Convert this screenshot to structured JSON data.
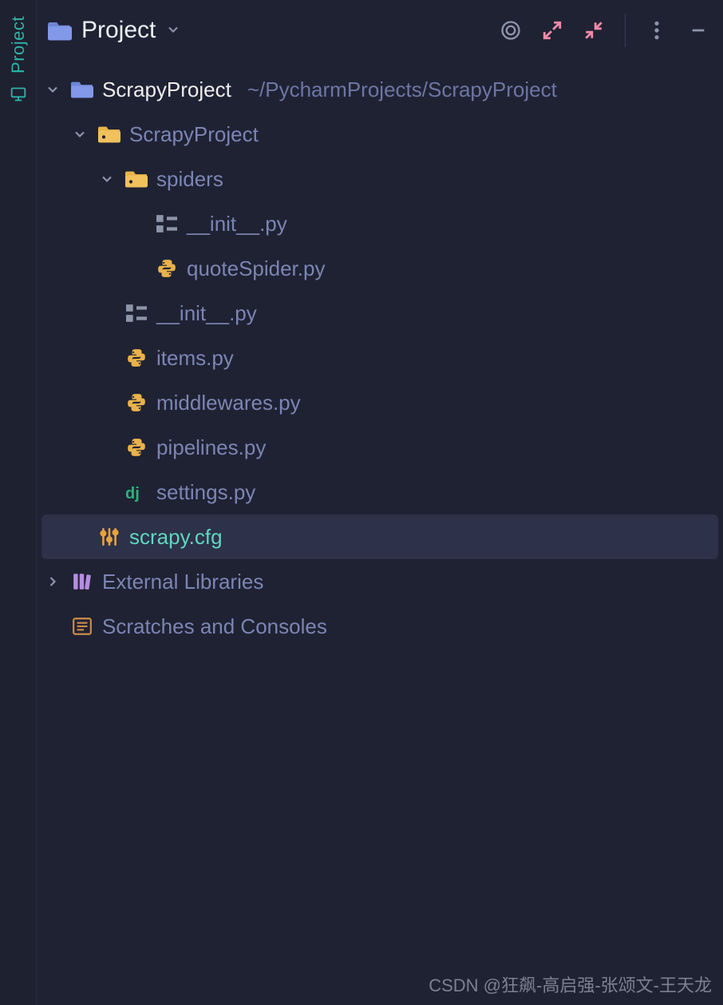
{
  "sidebar": {
    "tool_label": "Project"
  },
  "header": {
    "title": "Project"
  },
  "tree": {
    "root": {
      "name": "ScrapyProject",
      "path": "~/PycharmProjects/ScrapyProject"
    },
    "pkg": {
      "name": "ScrapyProject"
    },
    "spiders": {
      "name": "spiders"
    },
    "files": {
      "spiders_init": "__init__.py",
      "quoteSpider": "quoteSpider.py",
      "pkg_init": "__init__.py",
      "items": "items.py",
      "middlewares": "middlewares.py",
      "pipelines": "pipelines.py",
      "settings": "settings.py",
      "scrapy_cfg": "scrapy.cfg"
    },
    "external_libraries": "External Libraries",
    "scratches": "Scratches and Consoles"
  },
  "watermark": "CSDN @狂飙-高启强-张颂文-王天龙"
}
